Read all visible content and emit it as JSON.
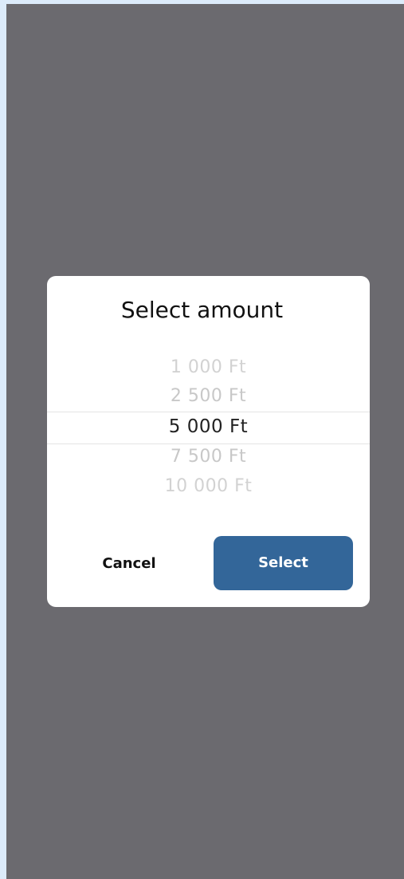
{
  "dialog": {
    "title": "Select amount",
    "options": [
      "1 000 Ft",
      "2 500 Ft",
      "5 000 Ft",
      "7 500 Ft",
      "10 000 Ft"
    ],
    "selected_value": "5 000 Ft",
    "cancel_label": "Cancel",
    "select_label": "Select"
  },
  "colors": {
    "backdrop": "#6b6a6f",
    "dialog_bg": "#ffffff",
    "accent": "#336699"
  }
}
